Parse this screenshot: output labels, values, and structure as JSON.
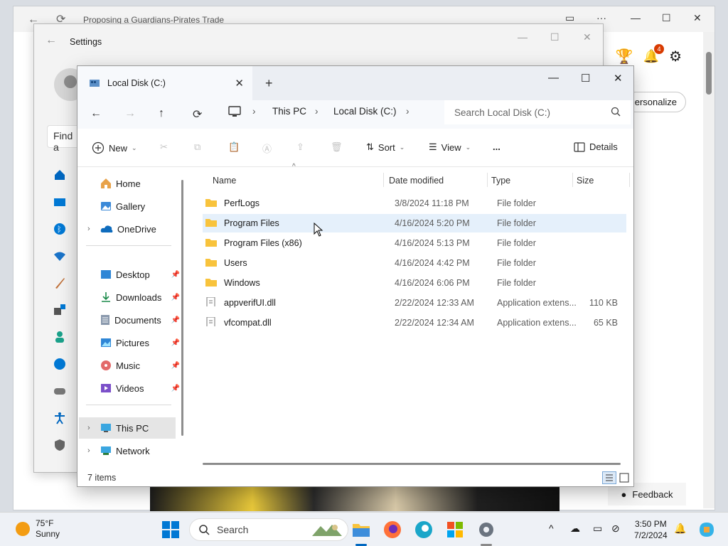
{
  "browser": {
    "tab_title": "Proposing a Guardians-Pirates Trade",
    "personalize_label": "ersonalize",
    "notification_count": "4",
    "feedback_label": "Feedback"
  },
  "settings": {
    "title": "Settings",
    "find_placeholder": "Find a"
  },
  "explorer": {
    "tab_title": "Local Disk (C:)",
    "breadcrumb": [
      "This PC",
      "Local Disk (C:)"
    ],
    "search_placeholder": "Search Local Disk (C:)",
    "commands": {
      "new": "New",
      "sort": "Sort",
      "view": "View",
      "more": "...",
      "details": "Details"
    },
    "nav": {
      "home": "Home",
      "gallery": "Gallery",
      "onedrive": "OneDrive",
      "desktop": "Desktop",
      "downloads": "Downloads",
      "documents": "Documents",
      "pictures": "Pictures",
      "music": "Music",
      "videos": "Videos",
      "thispc": "This PC",
      "network": "Network"
    },
    "columns": {
      "name": "Name",
      "date": "Date modified",
      "type": "Type",
      "size": "Size"
    },
    "files": [
      {
        "name": "PerfLogs",
        "date": "3/8/2024 11:18 PM",
        "type": "File folder",
        "size": "",
        "kind": "folder"
      },
      {
        "name": "Program Files",
        "date": "4/16/2024 5:20 PM",
        "type": "File folder",
        "size": "",
        "kind": "folder"
      },
      {
        "name": "Program Files (x86)",
        "date": "4/16/2024 5:13 PM",
        "type": "File folder",
        "size": "",
        "kind": "folder"
      },
      {
        "name": "Users",
        "date": "4/16/2024 4:42 PM",
        "type": "File folder",
        "size": "",
        "kind": "folder"
      },
      {
        "name": "Windows",
        "date": "4/16/2024 6:06 PM",
        "type": "File folder",
        "size": "",
        "kind": "folder"
      },
      {
        "name": "appverifUI.dll",
        "date": "2/22/2024 12:33 AM",
        "type": "Application extens...",
        "size": "110 KB",
        "kind": "file"
      },
      {
        "name": "vfcompat.dll",
        "date": "2/22/2024 12:34 AM",
        "type": "Application extens...",
        "size": "65 KB",
        "kind": "file"
      }
    ],
    "status": "7 items"
  },
  "taskbar": {
    "temperature": "75°F",
    "condition": "Sunny",
    "search_label": "Search",
    "time": "3:50 PM",
    "date": "7/2/2024"
  },
  "colors": {
    "accent": "#0067c0",
    "folder": "#f8c33c",
    "highlight": "#e5f0fb"
  }
}
